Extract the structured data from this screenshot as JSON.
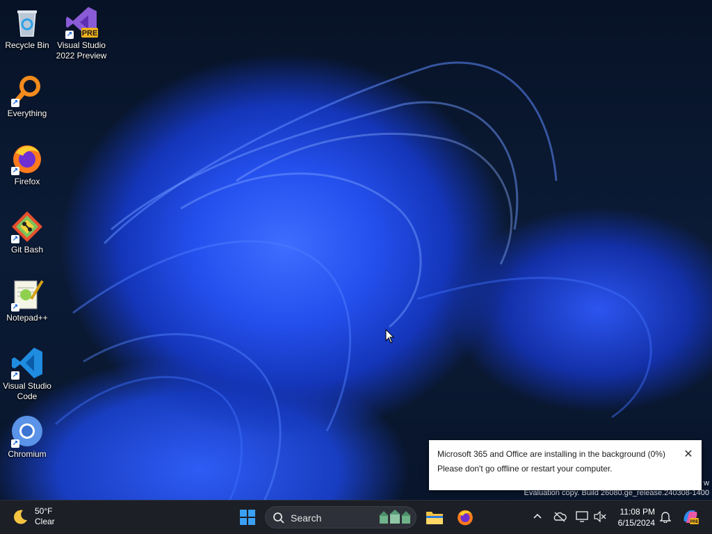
{
  "desktop": {
    "icons": [
      {
        "label": "Recycle Bin",
        "icon": "recycle-bin-icon"
      },
      {
        "label": "Visual Studio\n2022 Preview",
        "icon": "visual-studio-icon",
        "badge": "PRE"
      },
      {
        "label": "Everything",
        "icon": "everything-search-icon"
      },
      {
        "label": "Firefox",
        "icon": "firefox-icon"
      },
      {
        "label": "Git Bash",
        "icon": "git-bash-icon"
      },
      {
        "label": "Notepad++",
        "icon": "notepad-plus-plus-icon"
      },
      {
        "label": "Visual Studio\nCode",
        "icon": "vscode-icon"
      },
      {
        "label": "Chromium",
        "icon": "chromium-icon"
      }
    ],
    "watermark": {
      "line1": "w",
      "line2": "Evaluation copy. Build 26080.ge_release.240308-1400"
    }
  },
  "notification": {
    "line1": "Microsoft 365 and Office are installing in the background (0%)",
    "line2": "Please don't go offline or restart your computer.",
    "close_icon": "close-icon"
  },
  "taskbar": {
    "weather": {
      "temp": "50°F",
      "condition": "Clear",
      "icon": "moon-icon"
    },
    "start_icon": "windows-start-icon",
    "search": {
      "placeholder": "Search",
      "icon": "search-icon"
    },
    "apps": [
      "file-explorer-icon",
      "firefox-icon"
    ],
    "tray": {
      "icons": [
        "chevron-up-icon",
        "onedrive-icon",
        "display-icon",
        "volume-muted-icon",
        "notification-bell-icon",
        "copilot-icon"
      ],
      "time": "11:08 PM",
      "date": "6/15/2024"
    }
  },
  "colors": {
    "taskbar_bg": "#1c1f26",
    "accent": "#1e6fe0",
    "wallpaper_blue": "#2450ee"
  }
}
